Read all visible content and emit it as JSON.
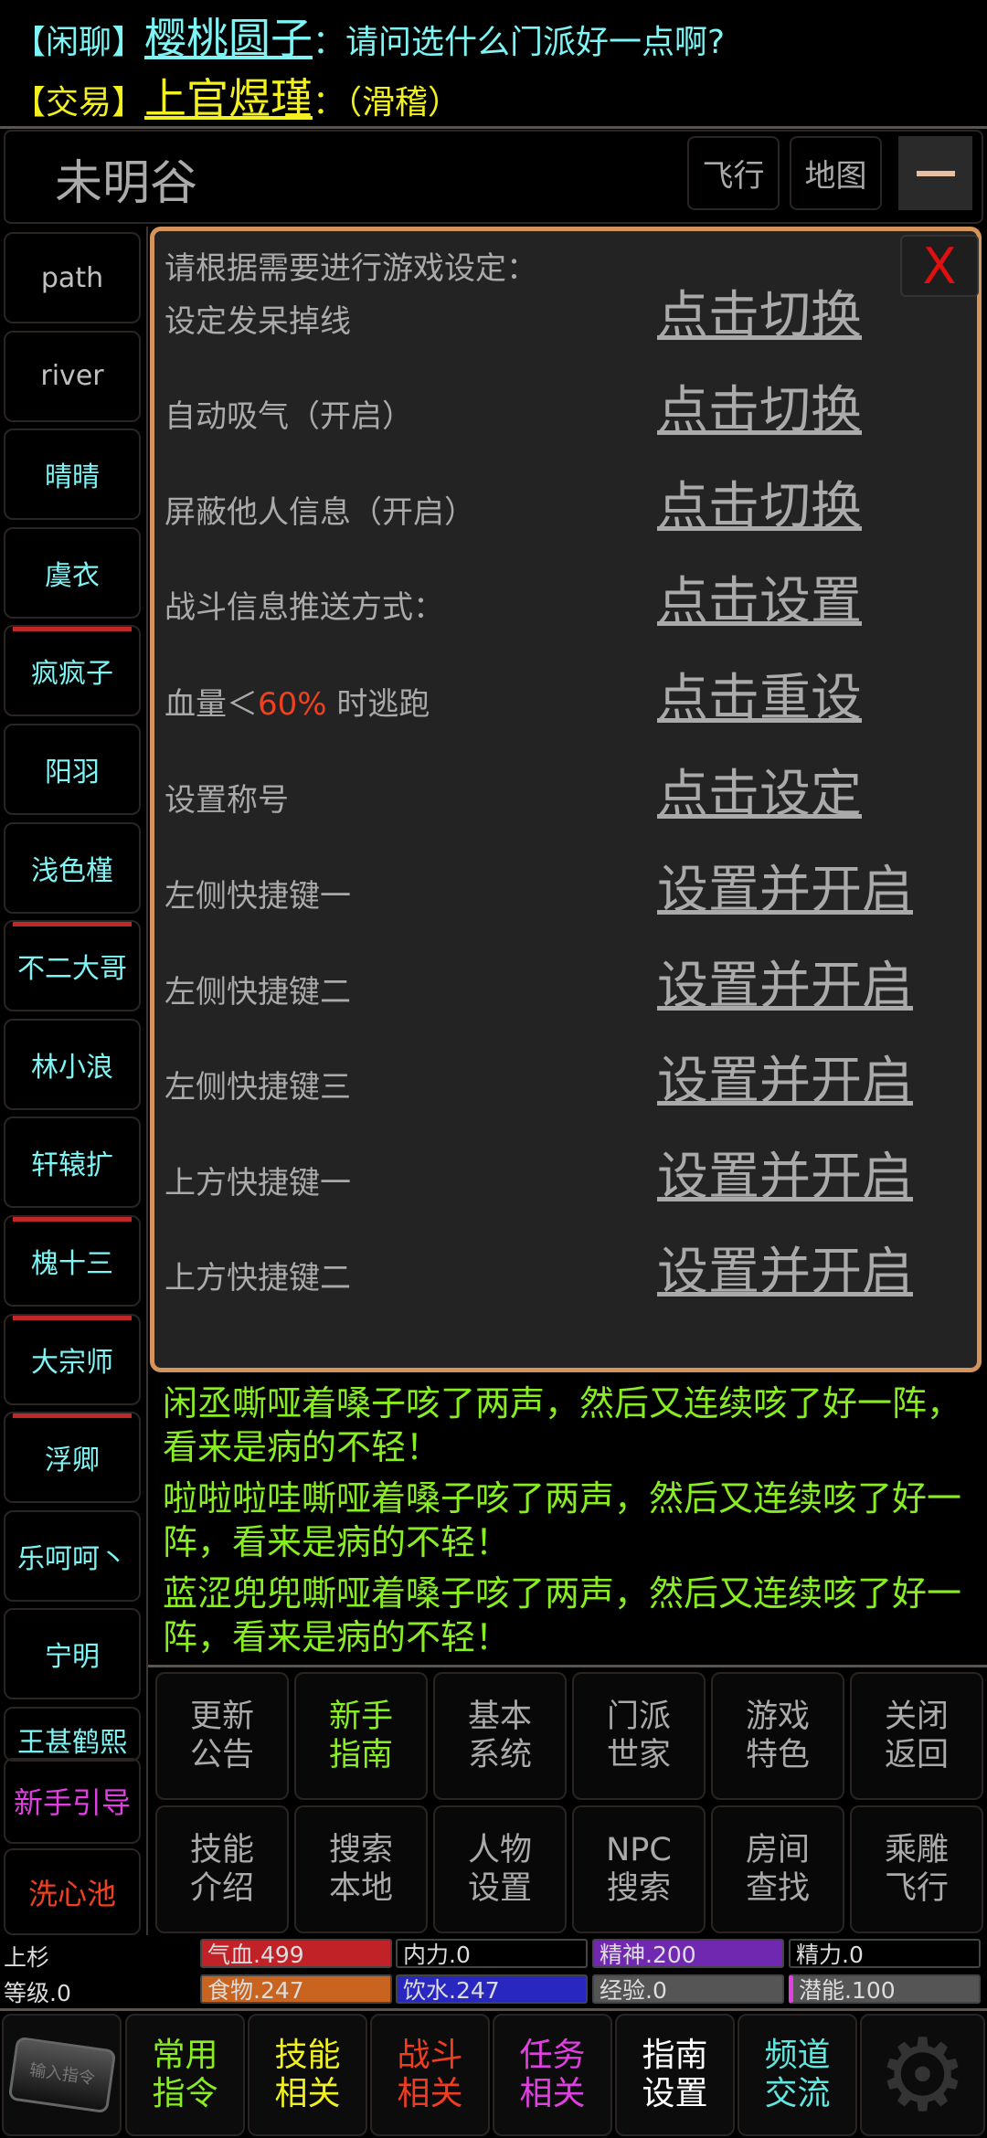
{
  "chat": [
    {
      "channel": "【闲聊】",
      "name": "樱桃圆子",
      "sep": "：",
      "msg": "请问选什么门派好一点啊?"
    },
    {
      "channel": "【交易】",
      "name": "上官煜瑾",
      "sep": "：",
      "msg": "（滑稽）"
    }
  ],
  "header": {
    "room": "未明谷",
    "fly": "飞行",
    "map": "地图"
  },
  "sidebar": [
    {
      "label": "path",
      "flag": false,
      "color": "#c0c0c0"
    },
    {
      "label": "river",
      "flag": false,
      "color": "#c0c0c0"
    },
    {
      "label": "晴晴",
      "flag": false
    },
    {
      "label": "虞衣",
      "flag": false
    },
    {
      "label": "疯疯子",
      "flag": true
    },
    {
      "label": "阳羽",
      "flag": false
    },
    {
      "label": "浅色槿",
      "flag": false
    },
    {
      "label": "不二大哥",
      "flag": true
    },
    {
      "label": "林小浪",
      "flag": false
    },
    {
      "label": "轩辕扩",
      "flag": false
    },
    {
      "label": "槐十三",
      "flag": true
    },
    {
      "label": "大宗师",
      "flag": true
    },
    {
      "label": "浮卿",
      "flag": true
    },
    {
      "label": "乐呵呵丶",
      "flag": false
    },
    {
      "label": "宁明",
      "flag": false
    },
    {
      "label": "王甚鹤熙",
      "flag": false
    }
  ],
  "overlay_buttons": [
    {
      "label": "新手引导",
      "color": "#e040e0"
    },
    {
      "label": "洗心池",
      "color": "#f04020"
    }
  ],
  "panel": {
    "intro": "请根据需要进行游戏设定：",
    "close": "X",
    "rows": [
      {
        "label": "设定发呆掉线",
        "action": "点击切换"
      },
      {
        "label": "自动吸气（开启）",
        "action": "点击切换"
      },
      {
        "label": "屏蔽他人信息（开启）",
        "action": "点击切换"
      },
      {
        "label": "战斗信息推送方式：",
        "action": "点击设置"
      },
      {
        "label_pre": "血量＜",
        "label_value": "60%",
        "label_post": " 时逃跑",
        "action": "点击重设"
      },
      {
        "label": "设置称号",
        "action": "点击设定"
      },
      {
        "label": "左侧快捷键一",
        "action": "设置并开启"
      },
      {
        "label": "左侧快捷键二",
        "action": "设置并开启"
      },
      {
        "label": "左侧快捷键三",
        "action": "设置并开启"
      },
      {
        "label": "上方快捷键一",
        "action": "设置并开启"
      },
      {
        "label": "上方快捷键二",
        "action": "设置并开启"
      }
    ]
  },
  "log": [
    "闲丞嘶哑着嗓子咳了两声，然后又连续咳了好一阵，看来是病的不轻！",
    "啦啦啦哇嘶哑着嗓子咳了两声，然后又连续咳了好一阵，看来是病的不轻！",
    "蓝涩兜兜嘶哑着嗓子咳了两声，然后又连续咳了好一阵，看来是病的不轻！"
  ],
  "menu": [
    {
      "l1": "更新",
      "l2": "公告",
      "color": "#aaaaaa"
    },
    {
      "l1": "新手",
      "l2": "指南",
      "color": "#88ee22"
    },
    {
      "l1": "基本",
      "l2": "系统",
      "color": "#aaaaaa"
    },
    {
      "l1": "门派",
      "l2": "世家",
      "color": "#aaaaaa"
    },
    {
      "l1": "游戏",
      "l2": "特色",
      "color": "#aaaaaa"
    },
    {
      "l1": "关闭",
      "l2": "返回",
      "color": "#aaaaaa"
    },
    {
      "l1": "技能",
      "l2": "介绍",
      "color": "#aaaaaa"
    },
    {
      "l1": "搜索",
      "l2": "本地",
      "color": "#aaaaaa"
    },
    {
      "l1": "人物",
      "l2": "设置",
      "color": "#aaaaaa"
    },
    {
      "l1": "NPC",
      "l2": "搜索",
      "color": "#aaaaaa"
    },
    {
      "l1": "房间",
      "l2": "查找",
      "color": "#aaaaaa"
    },
    {
      "l1": "乘雕",
      "l2": "飞行",
      "color": "#aaaaaa"
    }
  ],
  "stats": {
    "name": "上杉",
    "level": "等级.0",
    "bars": [
      {
        "label": "气血.499",
        "color": "#c02228",
        "fill": 1
      },
      {
        "label": "内力.0",
        "color": "#000000",
        "fill": 0
      },
      {
        "label": "精神.200",
        "color": "#7028b0",
        "fill": 1
      },
      {
        "label": "精力.0",
        "color": "#000000",
        "fill": 0
      },
      {
        "label": "食物.247",
        "color": "#c86420",
        "fill": 1
      },
      {
        "label": "饮水.247",
        "color": "#2828c0",
        "fill": 1
      },
      {
        "label": "经验.0",
        "color": "#555555",
        "fill": 1
      },
      {
        "label": "潜能.100",
        "color": "#555555",
        "fill": 1
      }
    ]
  },
  "bottom": {
    "input_label": "输入指令",
    "buttons": [
      {
        "l1": "常用",
        "l2": "指令",
        "color": "#88ee22"
      },
      {
        "l1": "技能",
        "l2": "相关",
        "color": "#f0f020"
      },
      {
        "l1": "战斗",
        "l2": "相关",
        "color": "#f03c20"
      },
      {
        "l1": "任务",
        "l2": "相关",
        "color": "#e040e0"
      },
      {
        "l1": "指南",
        "l2": "设置",
        "color": "#ffffff"
      },
      {
        "l1": "频道",
        "l2": "交流",
        "color": "#60e8e0"
      }
    ]
  }
}
